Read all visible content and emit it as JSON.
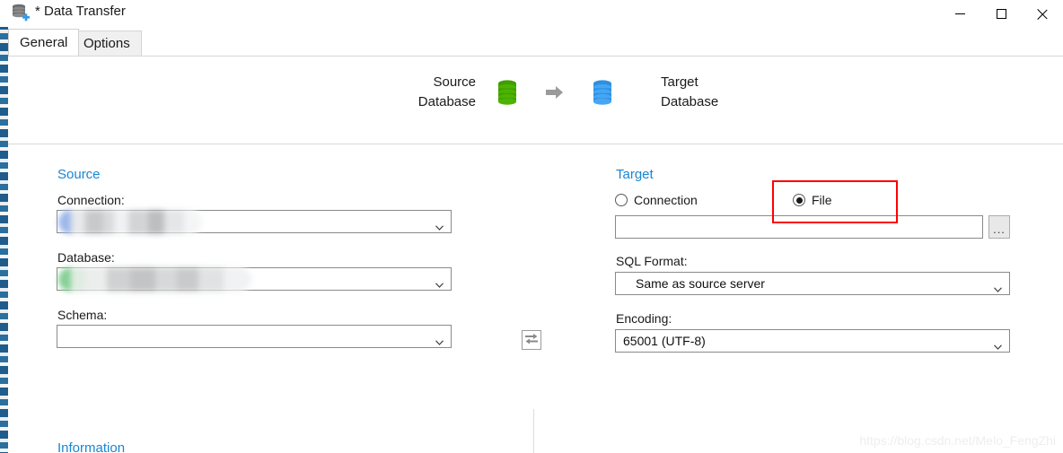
{
  "window": {
    "title": "* Data Transfer",
    "icon": "database-add-icon",
    "controls": {
      "minimize": "minimize-icon",
      "maximize": "maximize-icon",
      "close": "close-icon"
    }
  },
  "tabs": [
    {
      "label": "General",
      "active": true
    },
    {
      "label": "Options",
      "active": false
    }
  ],
  "header": {
    "source_label_line1": "Source",
    "source_label_line2": "Database",
    "target_label_line1": "Target",
    "target_label_line2": "Database",
    "source_icon": "database-green-icon",
    "target_icon": "database-blue-icon",
    "arrow_icon": "arrow-right-icon",
    "source_color": "#3f9e00",
    "target_color": "#3fa0f0",
    "arrow_color": "#9a9a9a"
  },
  "source": {
    "title": "Source",
    "title_color": "#1886d4",
    "connection_label": "Connection:",
    "connection_value": "",
    "connection_redacted": true,
    "database_label": "Database:",
    "database_value": "",
    "database_redacted": true,
    "schema_label": "Schema:",
    "schema_value": ""
  },
  "target": {
    "title": "Target",
    "title_color": "#1886d4",
    "radio_connection_label": "Connection",
    "radio_connection_selected": false,
    "radio_file_label": "File",
    "radio_file_selected": true,
    "file_path_value": "",
    "browse_label": "...",
    "sql_format_label": "SQL Format:",
    "sql_format_value": "Same as source server",
    "encoding_label": "Encoding:",
    "encoding_value": "65001 (UTF-8)"
  },
  "swap": {
    "icon": "swap-arrows-icon",
    "title": "Swap source and target"
  },
  "annotation": {
    "color": "#ff0000",
    "target_element": "file-radio-option"
  },
  "bottom": {
    "information_title": "Information"
  },
  "watermark": {
    "text": "https://blog.csdn.net/Melo_FengZhi"
  }
}
